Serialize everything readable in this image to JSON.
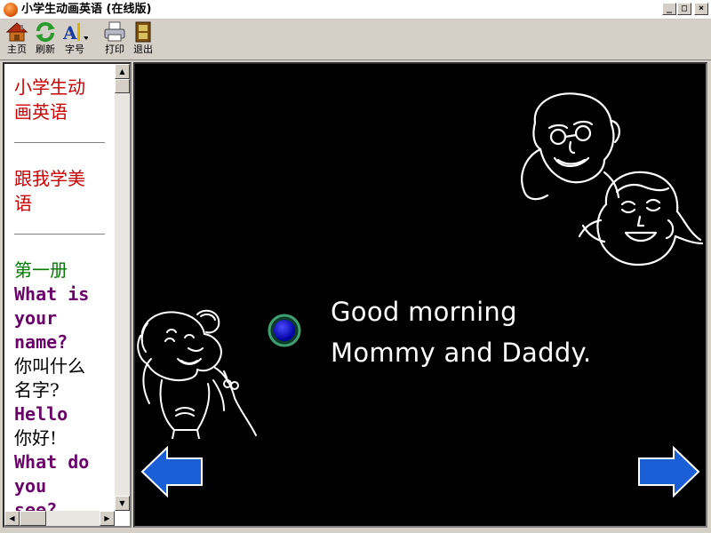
{
  "window": {
    "title": "小学生动画英语 (在线版)",
    "controls": {
      "minimize": "_",
      "maximize": "□",
      "close": "×"
    }
  },
  "toolbar": {
    "items": [
      {
        "label": "主页",
        "icon": "house-icon"
      },
      {
        "label": "刷新",
        "icon": "refresh-icon"
      },
      {
        "label": "字号",
        "icon": "font-size-icon"
      },
      {
        "label": "打印",
        "icon": "printer-icon"
      },
      {
        "label": "退出",
        "icon": "exit-door-icon"
      }
    ]
  },
  "sidebar": {
    "heading1": [
      "小学生动",
      "画英语"
    ],
    "heading2": [
      "跟我学美",
      "语"
    ],
    "book": "第一册",
    "lessons": [
      {
        "en": [
          "What is",
          "your",
          "name?"
        ],
        "zh": [
          "你叫什么",
          "名字?"
        ]
      },
      {
        "en": [
          "Hello"
        ],
        "zh": [
          "你好!"
        ]
      },
      {
        "en": [
          "What do",
          "you",
          "see?"
        ],
        "zh": []
      }
    ]
  },
  "scene": {
    "caption": [
      "Good morning",
      "Mommy and Daddy."
    ]
  },
  "colors": {
    "heading": "#cc0000",
    "book": "#007a00",
    "lesson_en": "#6a006a",
    "arrow": "#1a5fd6",
    "scene_bg": "#000000"
  }
}
